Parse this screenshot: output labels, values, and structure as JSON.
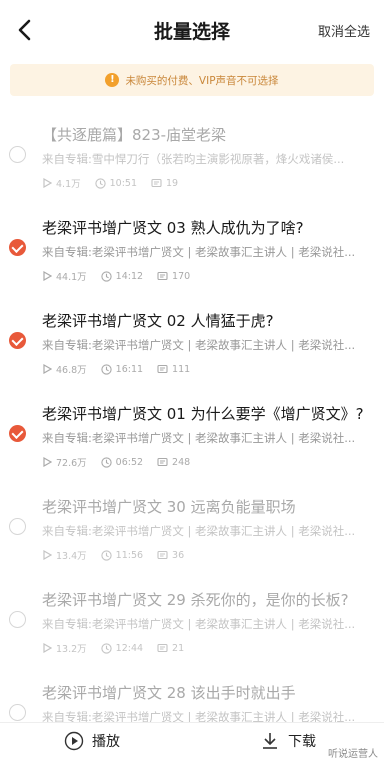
{
  "header": {
    "title": "批量选择",
    "cancel_all": "取消全选"
  },
  "notice": {
    "text": "未购买的付费、VIP声音不可选择"
  },
  "tracks": [
    {
      "title": "【共逐鹿篇】823-庙堂老梁",
      "source": "来自专辑:雪中悍刀行（张若昀主演影视原著，烽火戏诸侯...",
      "plays": "4.1万",
      "duration": "10:51",
      "comments": "19",
      "checked": false,
      "dim": true
    },
    {
      "title": "老梁评书增广贤文 03 熟人成仇为了啥?",
      "source": "来自专辑:老梁评书增广贤文 | 老梁故事汇主讲人 | 老梁说社...",
      "plays": "44.1万",
      "duration": "14:12",
      "comments": "170",
      "checked": true,
      "dim": false
    },
    {
      "title": "老梁评书增广贤文 02 人情猛于虎?",
      "source": "来自专辑:老梁评书增广贤文 | 老梁故事汇主讲人 | 老梁说社...",
      "plays": "46.8万",
      "duration": "16:11",
      "comments": "111",
      "checked": true,
      "dim": false
    },
    {
      "title": "老梁评书增广贤文 01 为什么要学《增广贤文》?",
      "source": "来自专辑:老梁评书增广贤文 | 老梁故事汇主讲人 | 老梁说社...",
      "plays": "72.6万",
      "duration": "06:52",
      "comments": "248",
      "checked": true,
      "dim": false
    },
    {
      "title": "老梁评书增广贤文 30 远离负能量职场",
      "source": "来自专辑:老梁评书增广贤文 | 老梁故事汇主讲人 | 老梁说社...",
      "plays": "13.4万",
      "duration": "11:56",
      "comments": "36",
      "checked": false,
      "dim": true
    },
    {
      "title": "老梁评书增广贤文 29 杀死你的，是你的长板?",
      "source": "来自专辑:老梁评书增广贤文 | 老梁故事汇主讲人 | 老梁说社...",
      "plays": "13.2万",
      "duration": "12:44",
      "comments": "21",
      "checked": false,
      "dim": true
    },
    {
      "title": "老梁评书增广贤文 28 该出手时就出手",
      "source": "来自专辑:老梁评书增广贤文 | 老梁故事汇主讲人 | 老梁说社...",
      "plays": "",
      "duration": "",
      "comments": "",
      "checked": false,
      "dim": true
    }
  ],
  "bottom": {
    "play_label": "播放",
    "download_label": "下载"
  },
  "watermark": "听说运营人",
  "colors": {
    "accent": "#e8593a",
    "notice_bg": "#fdf3e3",
    "notice_text": "#c9873a"
  },
  "icons": {
    "back": "chevron-left-icon",
    "play": "play-icon",
    "duration": "clock-icon",
    "comments": "comment-icon",
    "warning": "warning-icon",
    "download": "download-icon",
    "play_circle": "play-circle-icon"
  }
}
